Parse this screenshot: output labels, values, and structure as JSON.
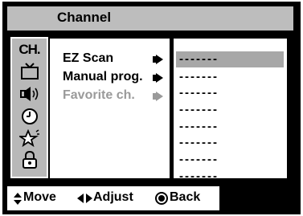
{
  "header": {
    "title": "Channel"
  },
  "sidebar": {
    "label": "CH.",
    "icons": [
      "tv-icon",
      "speaker-icon",
      "clock-icon",
      "star-icon",
      "lock-icon"
    ]
  },
  "menu": {
    "items": [
      {
        "label": "EZ Scan",
        "enabled": true
      },
      {
        "label": "Manual prog.",
        "enabled": true
      },
      {
        "label": "Favorite ch.",
        "enabled": false
      }
    ]
  },
  "submenu": {
    "rows": [
      "-------",
      "-------",
      "-------",
      "-------",
      "-------",
      "-------",
      "-------",
      "-------"
    ],
    "selected_index": 0
  },
  "footer": {
    "move_label": "Move",
    "adjust_label": "Adjust",
    "back_label": "Back"
  },
  "colors": {
    "frame": "#000000",
    "panel": "#bdbdbd",
    "highlight": "#a7a7a7",
    "disabled_text": "#9a9a9a",
    "text": "#000000"
  }
}
